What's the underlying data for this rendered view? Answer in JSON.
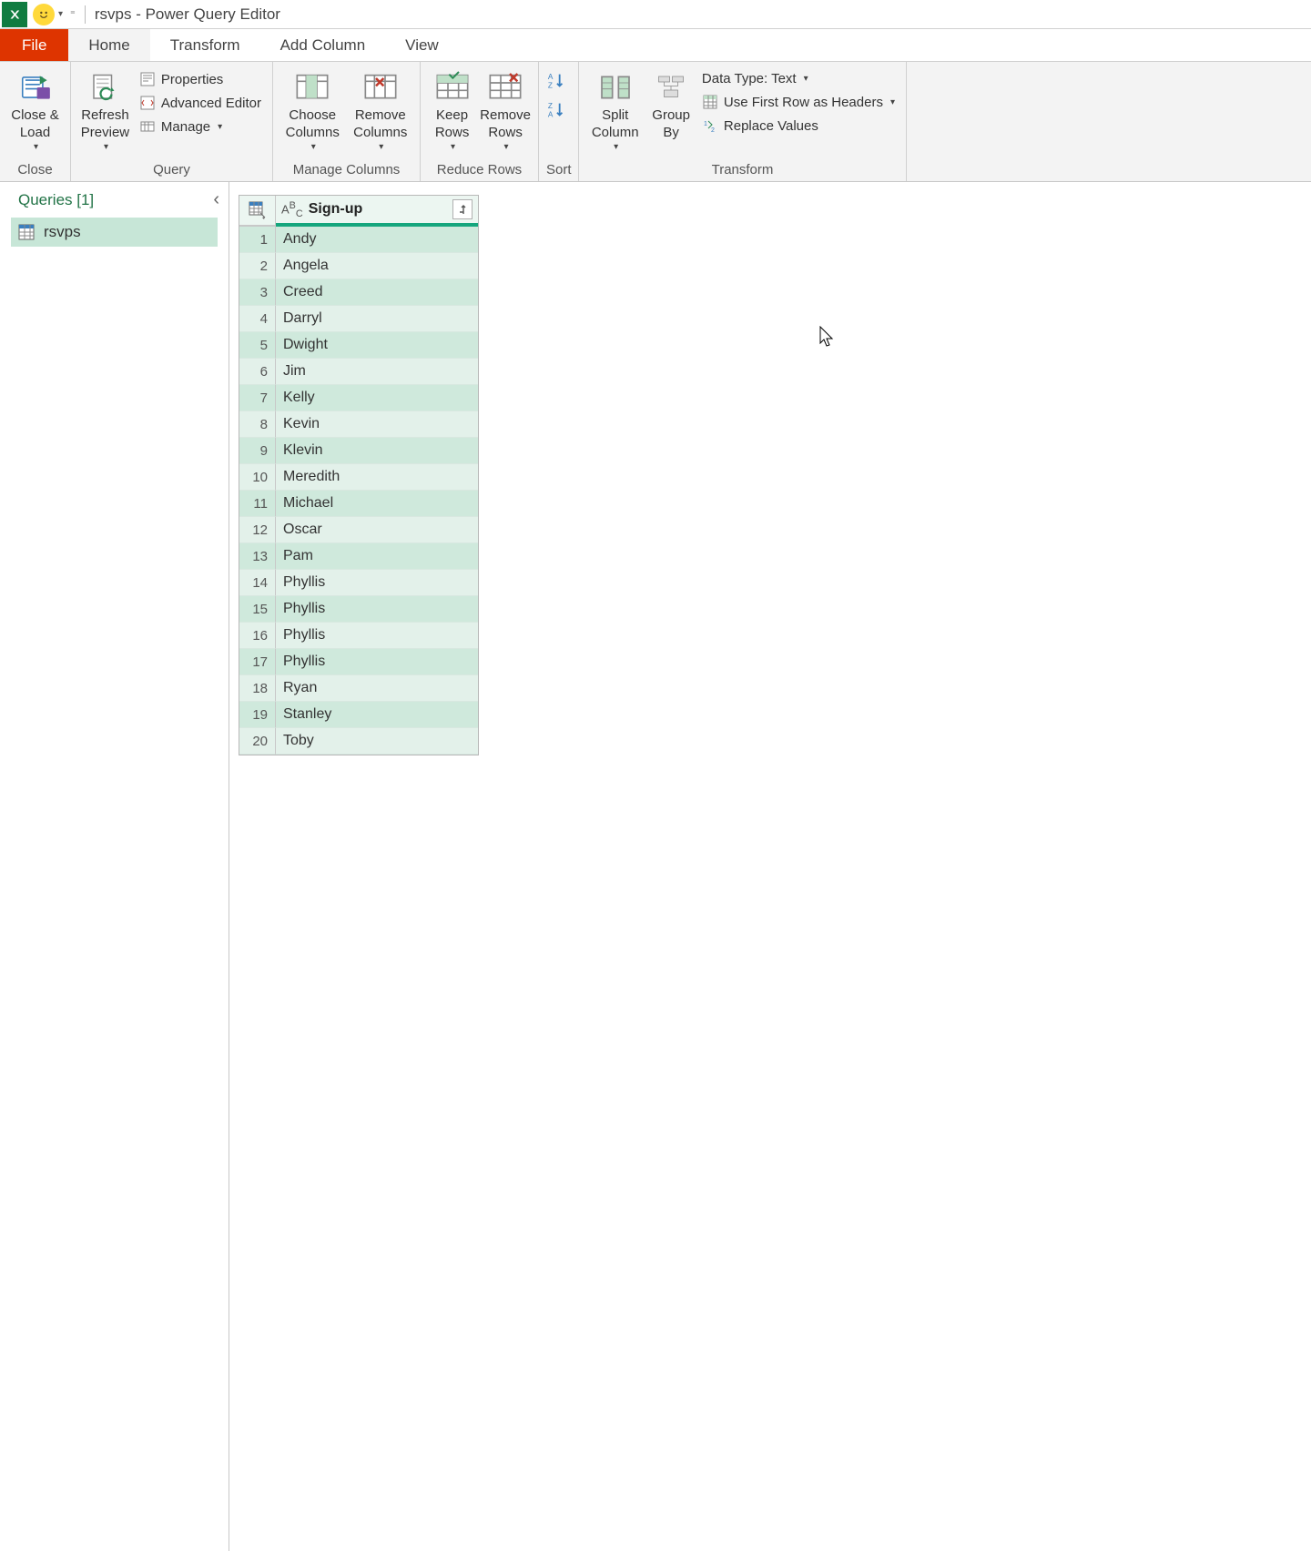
{
  "titlebar": {
    "query_name": "rsvps",
    "app_title": "Power Query Editor"
  },
  "tabs": {
    "file": "File",
    "home": "Home",
    "transform": "Transform",
    "add_column": "Add Column",
    "view": "View"
  },
  "ribbon": {
    "close": {
      "close_load": "Close &\nLoad",
      "group_label": "Close"
    },
    "query": {
      "refresh_preview": "Refresh\nPreview",
      "properties": "Properties",
      "advanced_editor": "Advanced Editor",
      "manage": "Manage",
      "group_label": "Query"
    },
    "manage_columns": {
      "choose_columns": "Choose\nColumns",
      "remove_columns": "Remove\nColumns",
      "group_label": "Manage Columns"
    },
    "reduce_rows": {
      "keep_rows": "Keep\nRows",
      "remove_rows": "Remove\nRows",
      "group_label": "Reduce Rows"
    },
    "sort": {
      "group_label": "Sort"
    },
    "transform": {
      "split_column": "Split\nColumn",
      "group_by": "Group\nBy",
      "data_type": "Data Type: Text",
      "first_row_headers": "Use First Row as Headers",
      "replace_values": "Replace Values",
      "group_label": "Transform"
    }
  },
  "queries_pane": {
    "header": "Queries [1]",
    "items": [
      {
        "name": "rsvps"
      }
    ]
  },
  "grid": {
    "column_header": "Sign-up",
    "type_indicator": "ABC",
    "rows": [
      "Andy",
      "Angela",
      "Creed",
      "Darryl",
      "Dwight",
      "Jim",
      "Kelly",
      "Kevin",
      "Klevin",
      "Meredith",
      "Michael",
      "Oscar",
      "Pam",
      "Phyllis",
      "Phyllis",
      "Phyllis",
      "Phyllis",
      "Ryan",
      "Stanley",
      "Toby"
    ]
  },
  "icons": {
    "excel": "excel",
    "smiley": "smiley"
  },
  "colors": {
    "accent": "#15a67d",
    "file_tab": "#de3400",
    "selection_bg": "#c7e6d7"
  }
}
